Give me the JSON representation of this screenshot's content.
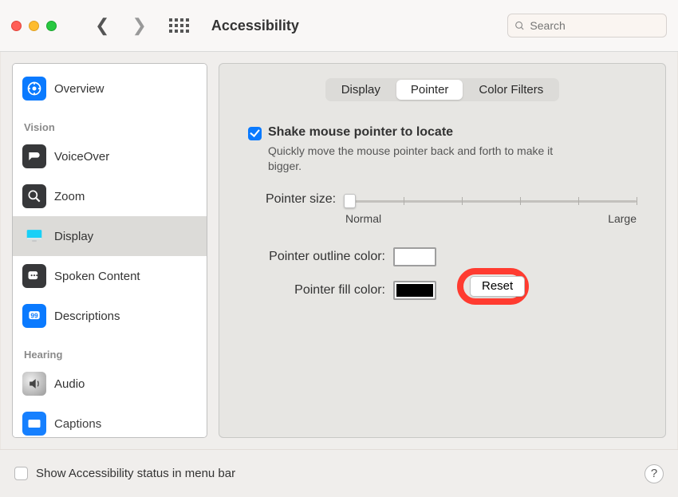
{
  "window": {
    "title": "Accessibility"
  },
  "search": {
    "placeholder": "Search"
  },
  "sidebar": {
    "sections": [
      {
        "items": [
          {
            "label": "Overview"
          }
        ]
      },
      {
        "header": "Vision",
        "items": [
          {
            "label": "VoiceOver"
          },
          {
            "label": "Zoom"
          },
          {
            "label": "Display",
            "selected": true
          },
          {
            "label": "Spoken Content"
          },
          {
            "label": "Descriptions"
          }
        ]
      },
      {
        "header": "Hearing",
        "items": [
          {
            "label": "Audio"
          },
          {
            "label": "Captions"
          }
        ]
      }
    ]
  },
  "tabs": {
    "items": [
      {
        "label": "Display"
      },
      {
        "label": "Pointer",
        "selected": true
      },
      {
        "label": "Color Filters"
      }
    ]
  },
  "settings": {
    "shake": {
      "label": "Shake mouse pointer to locate",
      "desc": "Quickly move the mouse pointer back and forth to make it bigger.",
      "checked": true
    },
    "pointerSize": {
      "label": "Pointer size:",
      "min": "Normal",
      "max": "Large"
    },
    "outline": {
      "label": "Pointer outline color:",
      "value": "#ffffff"
    },
    "fill": {
      "label": "Pointer fill color:",
      "value": "#000000"
    },
    "reset": {
      "label": "Reset"
    }
  },
  "footer": {
    "label": "Show Accessibility status in menu bar",
    "help": "?"
  }
}
